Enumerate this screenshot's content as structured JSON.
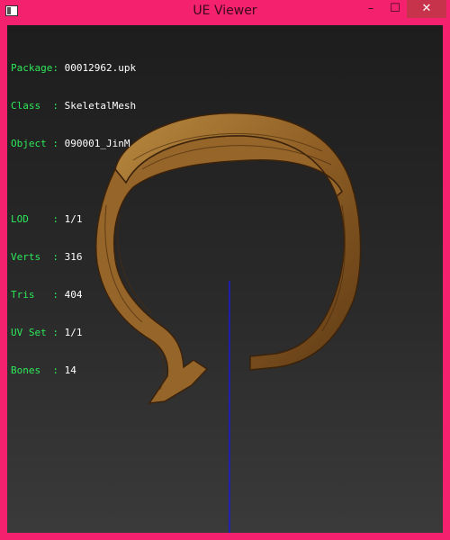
{
  "window": {
    "title": "UE Viewer",
    "min_glyph": "–",
    "max_glyph": "☐",
    "close_glyph": "✕"
  },
  "info": {
    "package_key": "Package:",
    "package_value": "00012962.upk",
    "class_key": "Class  :",
    "class_value": "SkeletalMesh",
    "object_key": "Object :",
    "object_value": "090001_JinM",
    "lod_key": "LOD    :",
    "lod_value": "1/1",
    "verts_key": "Verts  :",
    "verts_value": "316",
    "tris_key": "Tris   :",
    "tris_value": "404",
    "uv_key": "UV Set :",
    "uv_value": "1/1",
    "bones_key": "Bones  :",
    "bones_value": "14"
  },
  "colors": {
    "accent": "#ff1f6b",
    "label": "#2ee85a",
    "value": "#ffffff",
    "axis": "#1a1ad8",
    "wood": "#8a5a22"
  },
  "icons": {
    "app": "app-window-icon",
    "minimize": "minimize-icon",
    "maximize": "maximize-icon",
    "close": "close-icon"
  }
}
